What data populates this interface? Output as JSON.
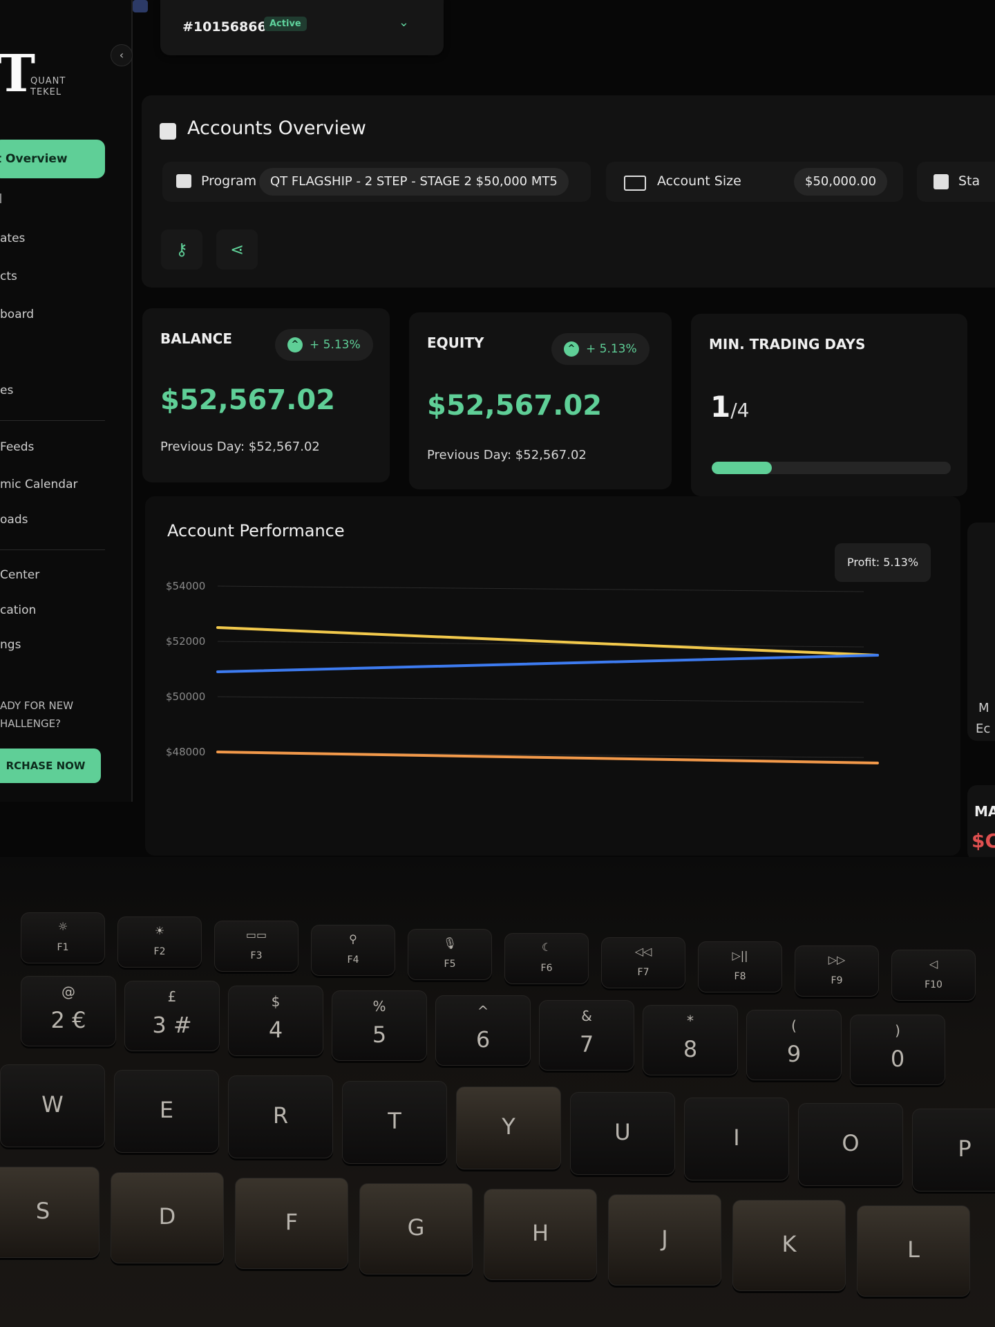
{
  "topbar": {
    "account_id": "#10156866",
    "account_status": "Active"
  },
  "sidebar": {
    "logo_mark": "T",
    "logo_line1": "QUANT",
    "logo_line2": "TEKEL",
    "active_item": "t Overview",
    "items": [
      "ates",
      "cts",
      "board",
      "es",
      "Feeds",
      "mic Calendar",
      "oads",
      "Center",
      "cation",
      "ngs"
    ],
    "promo_line1": "ADY FOR NEW",
    "promo_line2": "HALLENGE?",
    "purchase_label": "RCHASE NOW"
  },
  "overview": {
    "title": "Accounts Overview",
    "program_label": "Program",
    "program_value": "QT FLAGSHIP - 2 STEP - STAGE 2 $50,000 MT5",
    "size_label": "Account Size",
    "size_value": "$50,000.00",
    "start_label": "Sta"
  },
  "cards": {
    "balance": {
      "title": "BALANCE",
      "change": "+ 5.13%",
      "value": "$52,567.02",
      "previous": "Previous Day: $52,567.02"
    },
    "equity": {
      "title": "EQUITY",
      "change": "+ 5.13%",
      "value": "$52,567.02",
      "previous": "Previous Day: $52,567.02"
    },
    "trading_days": {
      "title": "MIN. TRADING DAYS",
      "current": "1",
      "total": "/4",
      "progress": 0.25
    }
  },
  "right_partial": {
    "label_m": "M",
    "label_ec": "Ec",
    "label_ma": "MA",
    "value": "$C"
  },
  "chart_data": {
    "type": "line",
    "title": "Account Performance",
    "tooltip": "Profit: 5.13%",
    "y_ticks": [
      "$54000",
      "$52000",
      "$50000",
      "$48000"
    ],
    "ylim": [
      47000,
      54000
    ],
    "x": [
      0,
      1
    ],
    "series": [
      {
        "color": "#f2c94c",
        "values": [
          52500,
          51500
        ]
      },
      {
        "color": "#3d7bf0",
        "values": [
          50900,
          51500
        ]
      },
      {
        "color": "#f2994a",
        "values": [
          48000,
          47600
        ]
      }
    ],
    "grid": true
  },
  "keyboard": {
    "fkeys": [
      {
        "icon": "☼",
        "label": "F1"
      },
      {
        "icon": "☀",
        "label": "F2"
      },
      {
        "icon": "▭▭",
        "label": "F3"
      },
      {
        "icon": "⚲",
        "label": "F4"
      },
      {
        "icon": "🎙",
        "label": "F5"
      },
      {
        "icon": "☾",
        "label": "F6"
      },
      {
        "icon": "◁◁",
        "label": "F7"
      },
      {
        "icon": "▷||",
        "label": "F8"
      },
      {
        "icon": "▷▷",
        "label": "F9"
      },
      {
        "icon": "◁",
        "label": "F10"
      }
    ],
    "numkeys": [
      {
        "top": "@",
        "main": "2 €"
      },
      {
        "top": "£",
        "main": "3 #"
      },
      {
        "top": "$",
        "main": "4"
      },
      {
        "top": "%",
        "main": "5"
      },
      {
        "top": "^",
        "main": "6"
      },
      {
        "top": "&",
        "main": "7"
      },
      {
        "top": "*",
        "main": "8"
      },
      {
        "top": "(",
        "main": "9"
      },
      {
        "top": ")",
        "main": "0"
      }
    ],
    "row_q": [
      "W",
      "E",
      "R",
      "T",
      "Y",
      "U",
      "I",
      "O",
      "P"
    ],
    "row_a": [
      "S",
      "D",
      "F",
      "G",
      "H",
      "J",
      "K",
      "L"
    ]
  }
}
